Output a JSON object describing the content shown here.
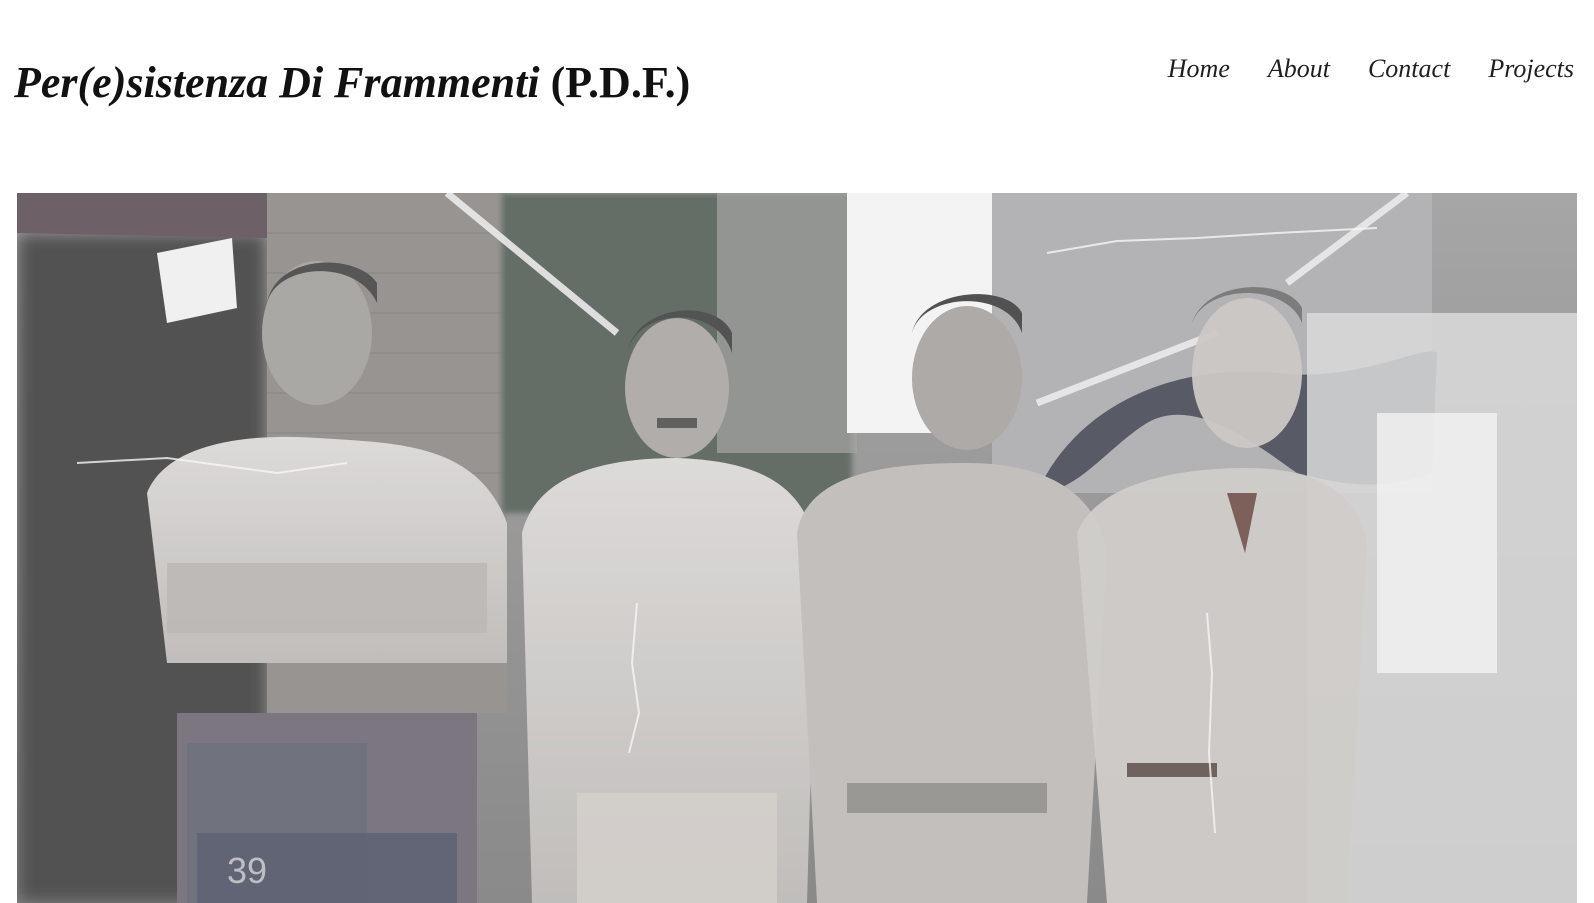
{
  "site": {
    "title_main": "Per(e)sistenza Di Frammenti",
    "title_abbr": "(P.D.F.)"
  },
  "nav": {
    "items": [
      {
        "label": "Home"
      },
      {
        "label": "About"
      },
      {
        "label": "Contact"
      },
      {
        "label": "Projects"
      }
    ]
  },
  "hero": {
    "description": "",
    "visible_plate_text": "39"
  },
  "colors": {
    "background": "#ffffff",
    "text": "#111111",
    "photo_tone": "#8a8a8a"
  }
}
